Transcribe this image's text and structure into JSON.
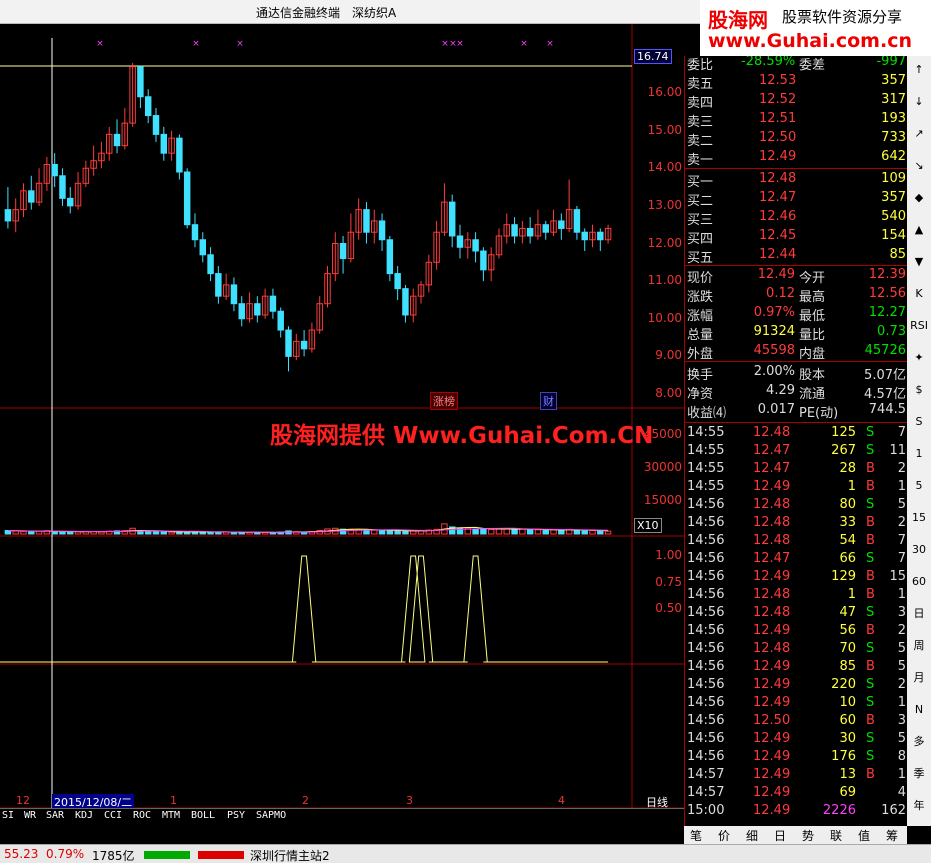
{
  "titlebar": {
    "app": "通达信金融终端",
    "stock": "深纺织A"
  },
  "logo": {
    "brand": "股海网",
    "slogan": "股票软件资源分享",
    "url": "www.Guhai.com.cn"
  },
  "watermark": "股海网提供 Www.Guhai.Com.CN",
  "price_axis": [
    "16.00",
    "15.00",
    "14.00",
    "13.00",
    "12.00",
    "11.00",
    "10.00",
    "9.00",
    "8.00"
  ],
  "current_price_tag": "16.74",
  "vol_axis": [
    "45000",
    "30000",
    "15000"
  ],
  "vol_scale": "X10",
  "ind_axis": [
    "1.00",
    "0.75",
    "0.50"
  ],
  "candles": [
    [
      12.9,
      12.6,
      13.5,
      12.4
    ],
    [
      12.6,
      12.9,
      13.2,
      12.3
    ],
    [
      12.9,
      13.4,
      13.6,
      12.7
    ],
    [
      13.4,
      13.1,
      13.8,
      12.9
    ],
    [
      13.1,
      13.6,
      14.0,
      13.0
    ],
    [
      13.6,
      14.1,
      14.3,
      13.4
    ],
    [
      14.1,
      13.8,
      14.4,
      13.5
    ],
    [
      13.8,
      13.2,
      14.0,
      13.0
    ],
    [
      13.2,
      13.0,
      13.5,
      12.8
    ],
    [
      13.0,
      13.6,
      13.9,
      12.9
    ],
    [
      13.6,
      14.0,
      14.2,
      13.5
    ],
    [
      14.0,
      14.2,
      14.6,
      13.8
    ],
    [
      14.2,
      14.4,
      14.7,
      14.0
    ],
    [
      14.4,
      14.9,
      15.1,
      14.2
    ],
    [
      14.9,
      14.6,
      15.3,
      14.4
    ],
    [
      14.6,
      15.2,
      15.6,
      14.5
    ],
    [
      15.2,
      16.7,
      16.8,
      15.1
    ],
    [
      16.7,
      15.9,
      16.5,
      15.6
    ],
    [
      15.9,
      15.4,
      16.1,
      15.2
    ],
    [
      15.4,
      14.9,
      15.6,
      14.7
    ],
    [
      14.9,
      14.4,
      15.1,
      14.2
    ],
    [
      14.4,
      14.8,
      15.0,
      14.2
    ],
    [
      14.8,
      13.9,
      14.9,
      13.7
    ],
    [
      13.9,
      12.5,
      14.0,
      12.4
    ],
    [
      12.5,
      12.1,
      12.8,
      11.9
    ],
    [
      12.1,
      11.7,
      12.3,
      11.5
    ],
    [
      11.7,
      11.2,
      11.9,
      11.0
    ],
    [
      11.2,
      10.6,
      11.4,
      10.4
    ],
    [
      10.6,
      10.9,
      11.2,
      10.5
    ],
    [
      10.9,
      10.4,
      11.1,
      10.2
    ],
    [
      10.4,
      10.0,
      10.6,
      9.8
    ],
    [
      10.0,
      10.4,
      10.7,
      9.9
    ],
    [
      10.4,
      10.1,
      10.6,
      9.9
    ],
    [
      10.1,
      10.6,
      10.8,
      10.0
    ],
    [
      10.6,
      10.2,
      10.8,
      10.0
    ],
    [
      10.2,
      9.7,
      10.3,
      9.5
    ],
    [
      9.7,
      9.0,
      9.8,
      8.6
    ],
    [
      9.0,
      9.4,
      9.6,
      8.9
    ],
    [
      9.4,
      9.2,
      9.7,
      9.0
    ],
    [
      9.2,
      9.7,
      9.9,
      9.1
    ],
    [
      9.7,
      10.4,
      10.6,
      9.6
    ],
    [
      10.4,
      11.2,
      11.4,
      10.3
    ],
    [
      11.2,
      12.0,
      12.3,
      11.0
    ],
    [
      12.0,
      11.6,
      12.2,
      11.2
    ],
    [
      11.6,
      12.3,
      12.8,
      11.5
    ],
    [
      12.3,
      12.9,
      13.2,
      12.1
    ],
    [
      12.9,
      12.3,
      13.1,
      12.0
    ],
    [
      12.3,
      12.6,
      12.9,
      12.0
    ],
    [
      12.6,
      12.1,
      12.8,
      11.8
    ],
    [
      12.1,
      11.2,
      12.2,
      11.0
    ],
    [
      11.2,
      10.8,
      11.4,
      10.5
    ],
    [
      10.8,
      10.1,
      10.9,
      9.9
    ],
    [
      10.1,
      10.6,
      10.8,
      9.9
    ],
    [
      10.6,
      10.9,
      11.0,
      10.4
    ],
    [
      10.9,
      11.5,
      11.7,
      10.7
    ],
    [
      11.5,
      12.3,
      12.6,
      11.3
    ],
    [
      12.3,
      13.1,
      13.6,
      12.2
    ],
    [
      13.1,
      12.2,
      13.3,
      11.9
    ],
    [
      12.2,
      11.9,
      12.5,
      11.6
    ],
    [
      11.9,
      12.1,
      12.3,
      11.6
    ],
    [
      12.1,
      11.8,
      12.3,
      11.5
    ],
    [
      11.8,
      11.3,
      11.9,
      11.0
    ],
    [
      11.3,
      11.7,
      11.9,
      11.0
    ],
    [
      11.7,
      12.2,
      12.4,
      11.6
    ],
    [
      12.2,
      12.5,
      12.8,
      12.0
    ],
    [
      12.5,
      12.2,
      12.7,
      12.0
    ],
    [
      12.2,
      12.4,
      12.6,
      12.0
    ],
    [
      12.4,
      12.2,
      12.7,
      12.0
    ],
    [
      12.2,
      12.5,
      12.9,
      12.1
    ],
    [
      12.5,
      12.3,
      12.6,
      12.1
    ],
    [
      12.3,
      12.6,
      12.9,
      12.2
    ],
    [
      12.6,
      12.4,
      12.8,
      12.1
    ],
    [
      12.4,
      12.9,
      13.7,
      12.3
    ],
    [
      12.9,
      12.3,
      13.0,
      12.1
    ],
    [
      12.3,
      12.1,
      12.4,
      11.8
    ],
    [
      12.1,
      12.3,
      12.5,
      11.9
    ],
    [
      12.3,
      12.1,
      12.4,
      11.8
    ],
    [
      12.1,
      12.4,
      12.5,
      12.0
    ]
  ],
  "volumes": [
    160,
    140,
    120,
    100,
    130,
    150,
    100,
    110,
    90,
    100,
    120,
    110,
    100,
    130,
    140,
    150,
    260,
    120,
    110,
    100,
    95,
    90,
    90,
    100,
    110,
    100,
    90,
    80,
    90,
    80,
    70,
    80,
    75,
    80,
    70,
    90,
    140,
    100,
    90,
    110,
    160,
    230,
    260,
    220,
    210,
    200,
    180,
    170,
    160,
    150,
    140,
    120,
    140,
    160,
    180,
    210,
    460,
    320,
    260,
    240,
    220,
    250,
    210,
    230,
    240,
    210,
    230,
    200,
    190,
    170,
    190,
    180,
    210,
    170,
    150,
    160,
    140,
    130
  ],
  "signal_bars": [
    38,
    52,
    53,
    60
  ],
  "date_axis": {
    "left": "12",
    "date": "2015/12/08/二",
    "m1": "1",
    "m2": "2",
    "m3": "3",
    "m4": "4",
    "period": "日线"
  },
  "chart_tags": {
    "zhangbang": "涨榜",
    "cai": "财"
  },
  "order_book": {
    "weibi_label": "委比",
    "weibi": "-28.59%",
    "weicha_label": "委差",
    "weicha": "-997",
    "asks": [
      {
        "label": "卖五",
        "price": "12.53",
        "vol": "357"
      },
      {
        "label": "卖四",
        "price": "12.52",
        "vol": "317"
      },
      {
        "label": "卖三",
        "price": "12.51",
        "vol": "193"
      },
      {
        "label": "卖二",
        "price": "12.50",
        "vol": "733"
      },
      {
        "label": "卖一",
        "price": "12.49",
        "vol": "642"
      }
    ],
    "bids": [
      {
        "label": "买一",
        "price": "12.48",
        "vol": "109"
      },
      {
        "label": "买二",
        "price": "12.47",
        "vol": "357"
      },
      {
        "label": "买三",
        "price": "12.46",
        "vol": "540"
      },
      {
        "label": "买四",
        "price": "12.45",
        "vol": "154"
      },
      {
        "label": "买五",
        "price": "12.44",
        "vol": "85"
      }
    ]
  },
  "quote": [
    {
      "l1": "现价",
      "v1": "12.49",
      "c1": "red",
      "l2": "今开",
      "v2": "12.39",
      "c2": "red"
    },
    {
      "l1": "涨跌",
      "v1": "0.12",
      "c1": "red",
      "l2": "最高",
      "v2": "12.56",
      "c2": "red"
    },
    {
      "l1": "涨幅",
      "v1": "0.97%",
      "c1": "red",
      "l2": "最低",
      "v2": "12.27",
      "c2": "green"
    },
    {
      "l1": "总量",
      "v1": "91324",
      "c1": "yellow",
      "l2": "量比",
      "v2": "0.73",
      "c2": "green"
    },
    {
      "l1": "外盘",
      "v1": "45598",
      "c1": "red",
      "l2": "内盘",
      "v2": "45726",
      "c2": "green"
    }
  ],
  "fundamentals": [
    {
      "l1": "换手",
      "v1": "2.00%",
      "l2": "股本",
      "v2": "5.07亿"
    },
    {
      "l1": "净资",
      "v1": "4.29",
      "l2": "流通",
      "v2": "4.57亿"
    },
    {
      "l1": "收益⑷",
      "v1": "0.017",
      "l2": "PE(动)",
      "v2": "744.5"
    }
  ],
  "ticks": [
    [
      "14:55",
      "12.48",
      "125",
      "S",
      "7"
    ],
    [
      "14:55",
      "12.47",
      "267",
      "S",
      "11"
    ],
    [
      "14:55",
      "12.47",
      "28",
      "B",
      "2"
    ],
    [
      "14:55",
      "12.49",
      "1",
      "B",
      "1"
    ],
    [
      "14:56",
      "12.48",
      "80",
      "S",
      "5"
    ],
    [
      "14:56",
      "12.48",
      "33",
      "B",
      "2"
    ],
    [
      "14:56",
      "12.48",
      "54",
      "B",
      "7"
    ],
    [
      "14:56",
      "12.47",
      "66",
      "S",
      "7"
    ],
    [
      "14:56",
      "12.49",
      "129",
      "B",
      "15"
    ],
    [
      "14:56",
      "12.48",
      "1",
      "B",
      "1"
    ],
    [
      "14:56",
      "12.48",
      "47",
      "S",
      "3"
    ],
    [
      "14:56",
      "12.49",
      "56",
      "B",
      "2"
    ],
    [
      "14:56",
      "12.48",
      "70",
      "S",
      "5"
    ],
    [
      "14:56",
      "12.49",
      "85",
      "B",
      "5"
    ],
    [
      "14:56",
      "12.49",
      "220",
      "S",
      "2"
    ],
    [
      "14:56",
      "12.49",
      "10",
      "S",
      "1"
    ],
    [
      "14:56",
      "12.50",
      "60",
      "B",
      "3"
    ],
    [
      "14:56",
      "12.49",
      "30",
      "S",
      "5"
    ],
    [
      "14:56",
      "12.49",
      "176",
      "S",
      "8"
    ],
    [
      "14:57",
      "12.49",
      "13",
      "B",
      "1"
    ],
    [
      "14:57",
      "12.49",
      "69",
      "",
      "4"
    ],
    [
      "15:00",
      "12.49",
      "2226",
      "",
      "162"
    ]
  ],
  "indicator_tabs": [
    "SI",
    "WR",
    "SAR",
    "KDJ",
    "CCI",
    "ROC",
    "MTM",
    "BOLL",
    "PSY",
    "SAPMO"
  ],
  "trade_tabs": [
    "笔",
    "价",
    "细",
    "日",
    "势",
    "联",
    "值",
    "筹"
  ],
  "toolstrip": [
    "↑",
    "↓",
    "↗",
    "↘",
    "◆",
    "▲",
    "▼",
    "K",
    "RSI",
    "✦",
    "$",
    "S",
    "1",
    "5",
    "15",
    "30",
    "60",
    "日",
    "周",
    "月",
    "N",
    "多",
    "季",
    "年"
  ],
  "status": {
    "index": "55.23",
    "pct": "0.79%",
    "amount": "1785亿",
    "server": "深圳行情主站2"
  },
  "colors": {
    "up": "#ff3b3b",
    "down": "#40e0ff",
    "ma5": "#ffff60",
    "ma10": "#ff40ff",
    "grid": "#a00000"
  }
}
